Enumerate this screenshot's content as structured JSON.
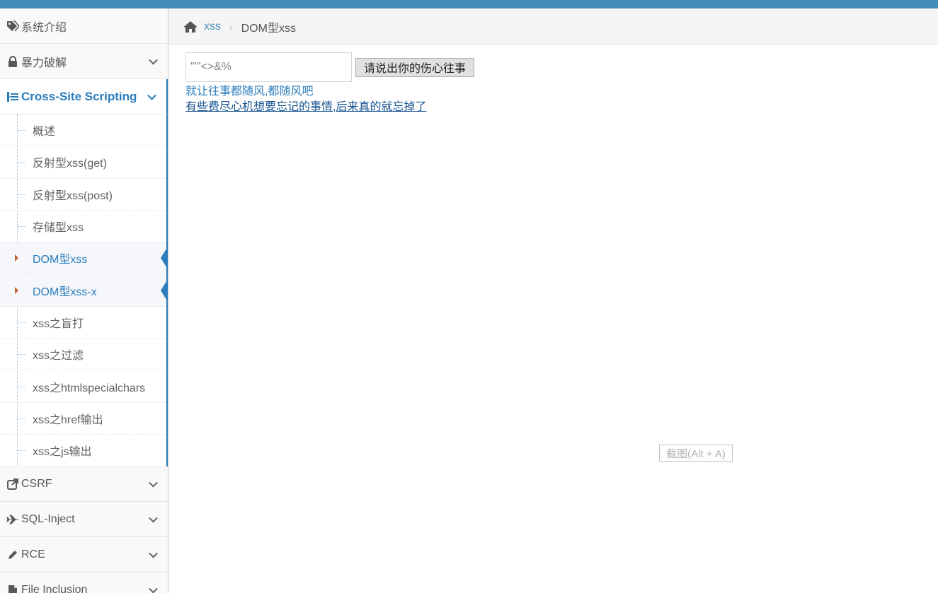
{
  "sidebar": {
    "items": [
      {
        "label": "系统介绍",
        "icon": "tags-icon"
      },
      {
        "label": "暴力破解",
        "icon": "lock-icon"
      },
      {
        "label": "Cross-Site Scripting",
        "icon": "sitemap-icon"
      },
      {
        "label": "CSRF",
        "icon": "share-icon"
      },
      {
        "label": "SQL-Inject",
        "icon": "plane-icon"
      },
      {
        "label": "RCE",
        "icon": "pencil-icon"
      },
      {
        "label": "File Inclusion",
        "icon": "file-icon"
      }
    ],
    "xss_submenu": [
      "概述",
      "反射型xss(get)",
      "反射型xss(post)",
      "存储型xss",
      "DOM型xss",
      "DOM型xss-x",
      "xss之盲打",
      "xss之过滤",
      "xss之htmlspecialchars",
      "xss之href输出",
      "xss之js输出"
    ]
  },
  "breadcrumb": {
    "home_icon": "home-icon",
    "link": "xss",
    "current": "DOM型xss"
  },
  "form": {
    "input_value": "\"'\"<>&%",
    "button_label": "请说出你的伤心往事"
  },
  "result": {
    "message": "就让往事都随风,都随风吧",
    "link_text": "有些费尽心机想要忘记的事情,后来真的就忘掉了"
  },
  "screenshot_tip": "截图(Alt + A)",
  "colors": {
    "top_bar": "#438eb9",
    "accent": "#2b7dbc",
    "link": "#15508f",
    "arrow": "#c86139"
  }
}
